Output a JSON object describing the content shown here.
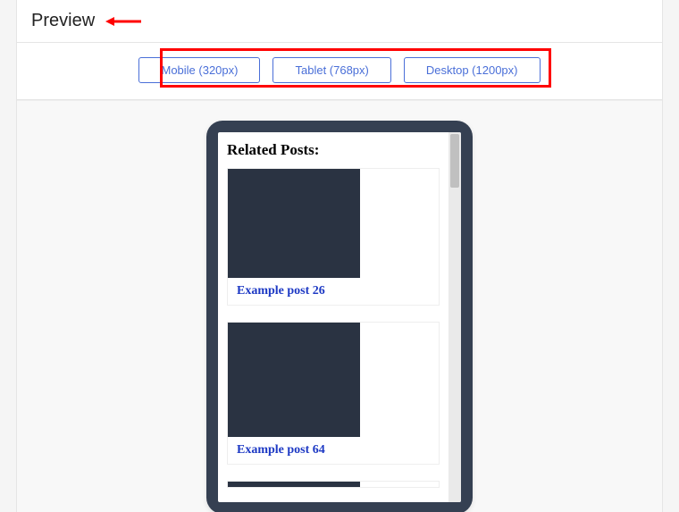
{
  "header": {
    "title": "Preview"
  },
  "toolbar": {
    "buttons": [
      "Mobile (320px)",
      "Tablet (768px)",
      "Desktop (1200px)"
    ]
  },
  "preview": {
    "related_heading": "Related Posts:",
    "posts": [
      {
        "title": "Example post 26"
      },
      {
        "title": "Example post 64"
      }
    ]
  },
  "colors": {
    "accent": "#4a6fd8",
    "highlight": "#ff0000",
    "device_frame": "#354052",
    "thumb_fill": "#2a3342",
    "link": "#1d39c4"
  }
}
